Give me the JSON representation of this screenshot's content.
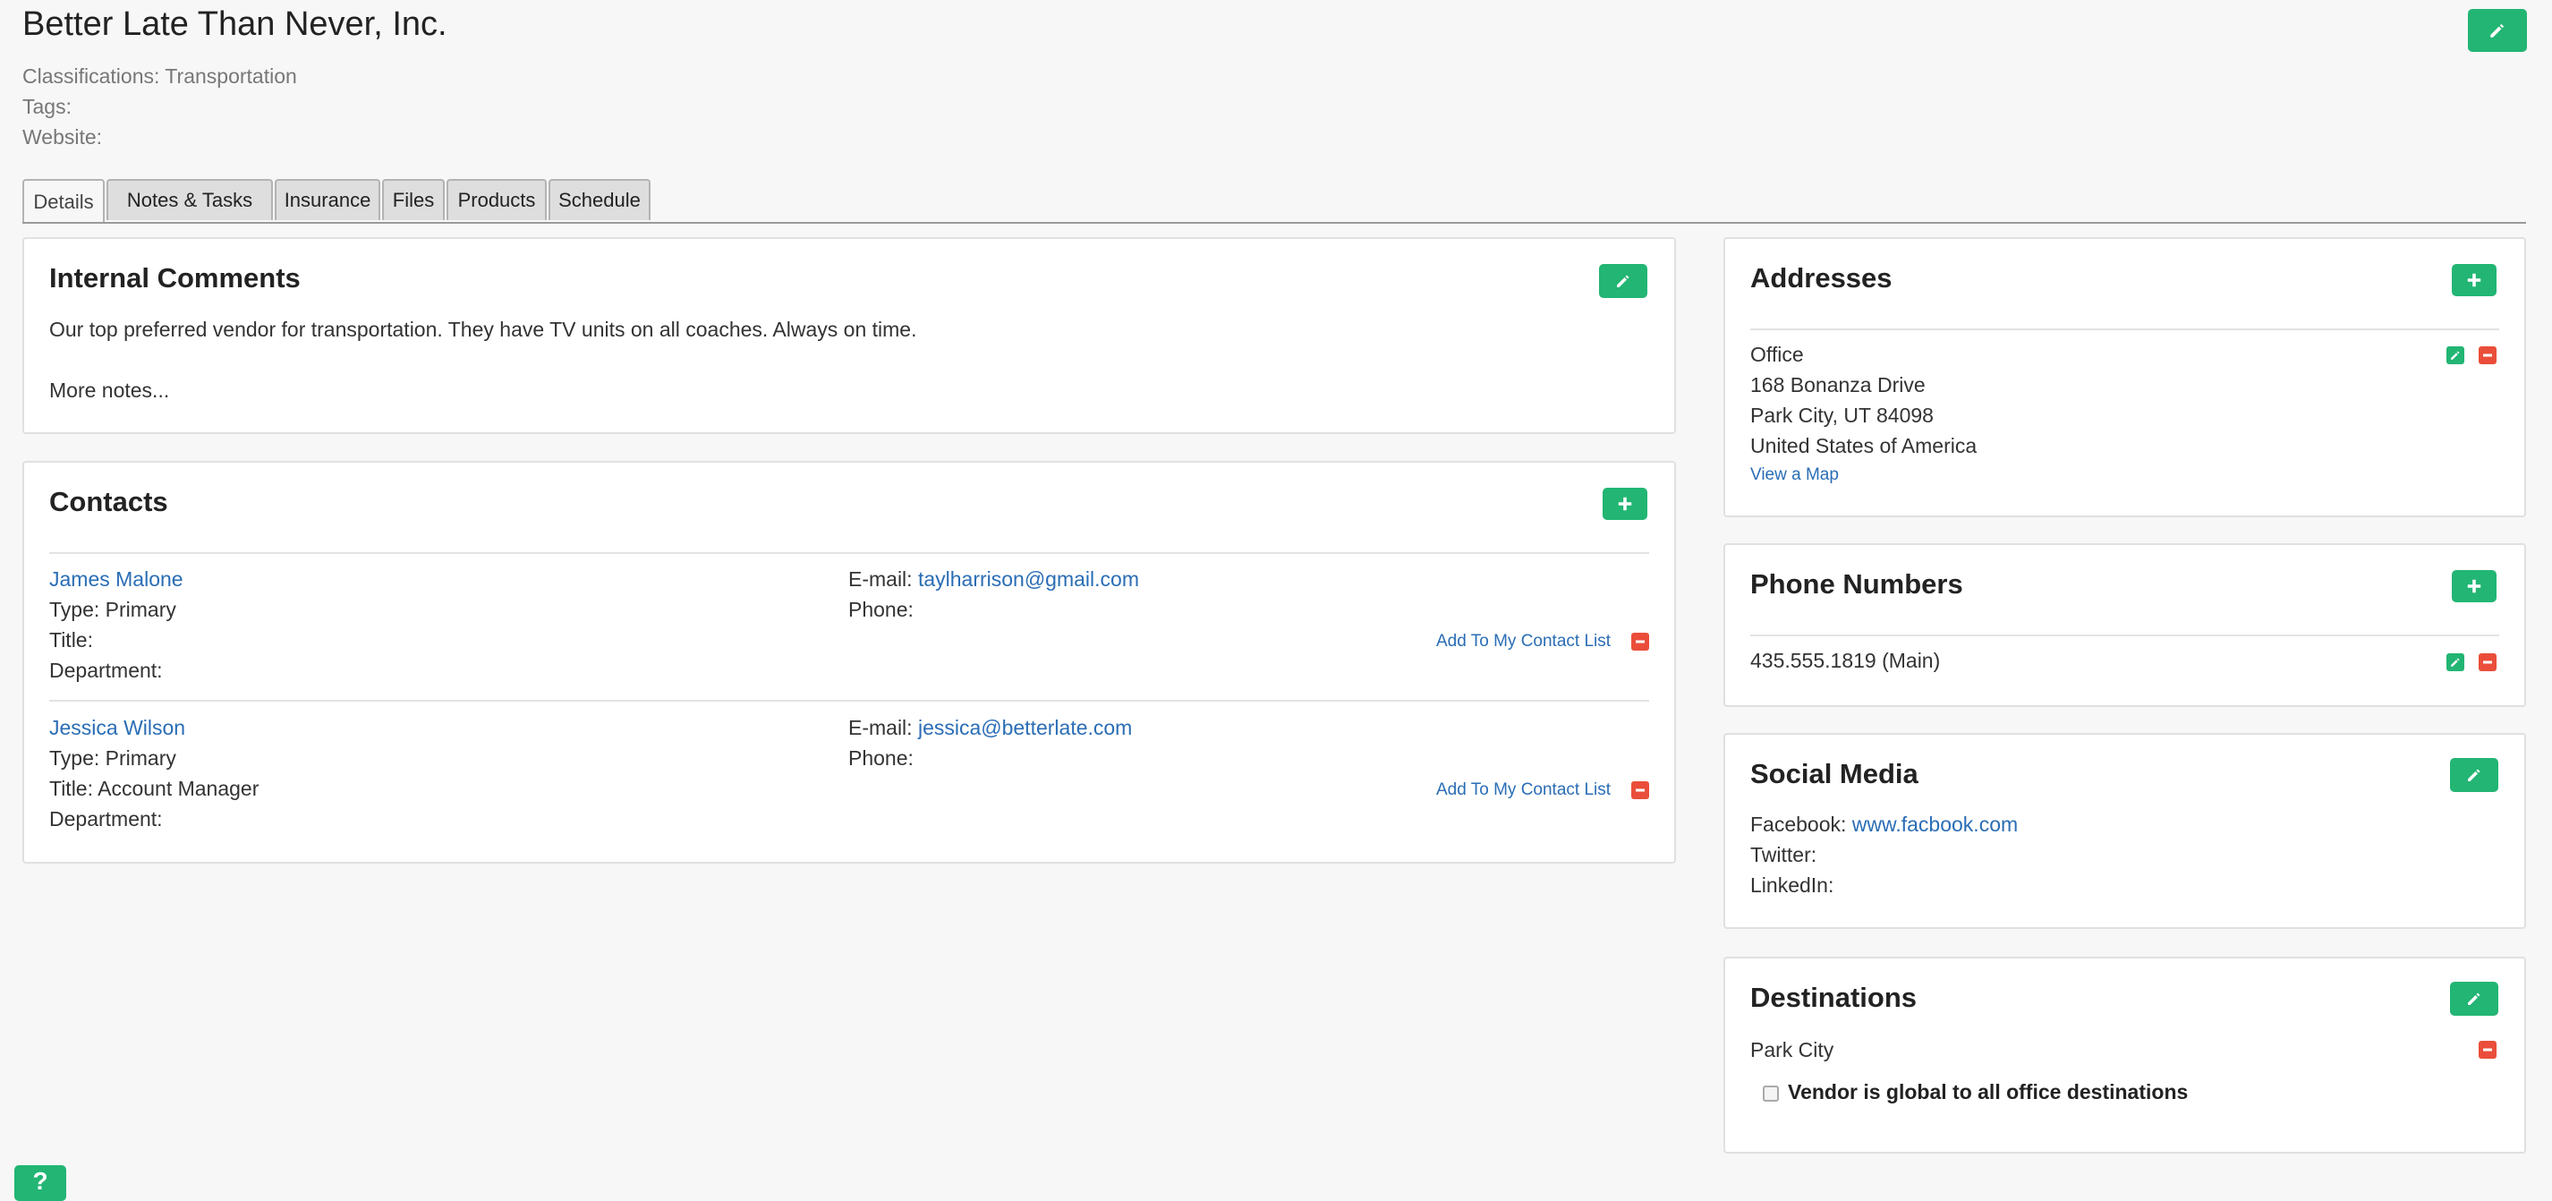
{
  "company": {
    "name": "Better Late Than Never, Inc.",
    "classifications": "Classifications: Transportation",
    "tags": "Tags:",
    "website": "Website:"
  },
  "tabs": [
    "Details",
    "Notes & Tasks",
    "Insurance",
    "Files",
    "Products",
    "Schedule"
  ],
  "internal_comments": {
    "title": "Internal Comments",
    "line1": "Our top preferred vendor for transportation. They have TV units on all coaches. Always on time.",
    "line2": "More notes..."
  },
  "contacts": {
    "title": "Contacts",
    "email_label": "E-mail:",
    "phone_label": "Phone:",
    "add_link": "Add To My Contact List",
    "items": [
      {
        "name": "James Malone",
        "type": "Type: Primary",
        "title": "Title:",
        "department": "Department:",
        "email": "taylharrison@gmail.com"
      },
      {
        "name": "Jessica Wilson",
        "type": "Type: Primary",
        "title": "Title: Account Manager",
        "department": "Department:",
        "email": "jessica@betterlate.com"
      }
    ]
  },
  "addresses": {
    "title": "Addresses",
    "label": "Office",
    "street": "168 Bonanza Drive",
    "city": "Park City, UT 84098",
    "country": "United States of America",
    "map_link": "View a Map"
  },
  "phones": {
    "title": "Phone Numbers",
    "main": "435.555.1819 (Main)"
  },
  "social": {
    "title": "Social Media",
    "facebook_label": "Facebook:",
    "facebook_link": "www.facbook.com",
    "twitter_label": "Twitter:",
    "linkedin_label": "LinkedIn:"
  },
  "destinations": {
    "title": "Destinations",
    "item": "Park City",
    "global_label": "Vendor is global to all office destinations"
  },
  "help": {
    "label": "?"
  },
  "icons": {
    "edit": "pencil-icon",
    "add": "plus-icon",
    "remove": "minus-icon"
  },
  "colors": {
    "accent_green": "#22b573",
    "danger_red": "#ea4e3a",
    "link_blue": "#2a6db5"
  }
}
